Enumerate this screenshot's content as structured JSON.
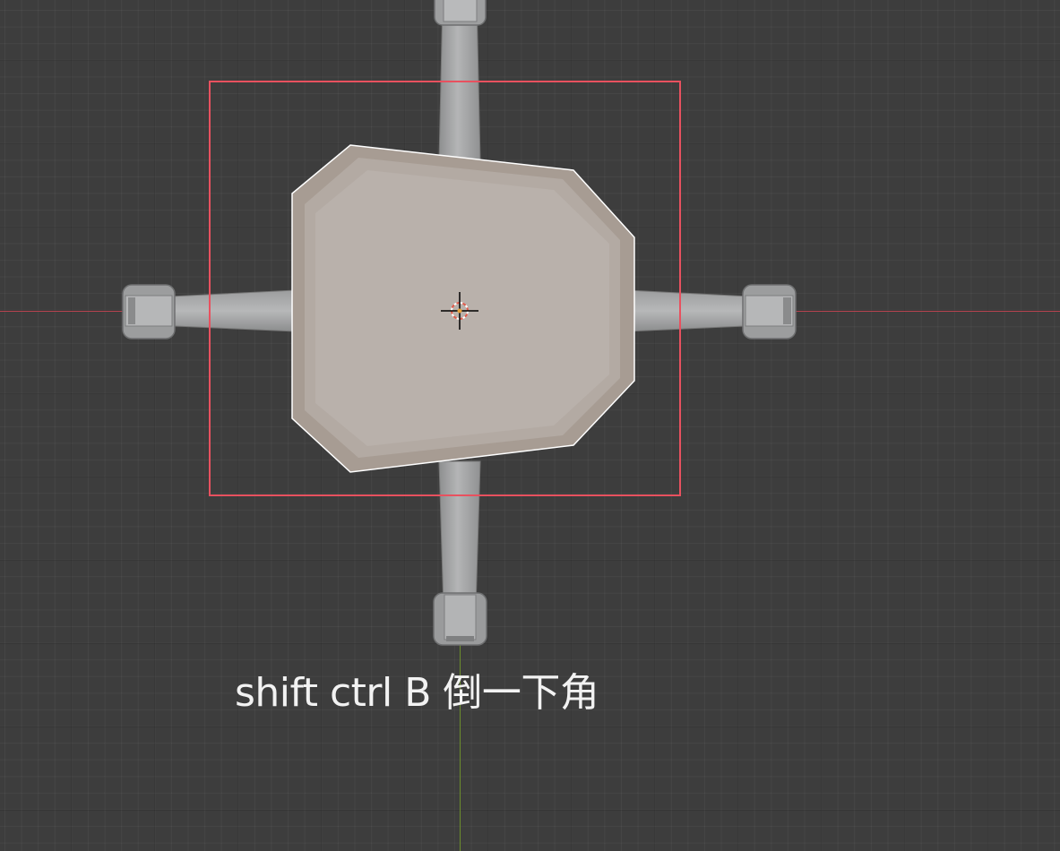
{
  "viewport": {
    "background_color": "#3d3d3d",
    "x_axis_color": "#b8434f",
    "y_axis_color": "#6c8e2c"
  },
  "selection_box": {
    "color": "#e8515f"
  },
  "seat": {
    "color": "#b8b0aa",
    "bevel_color": "#a79c93",
    "outline_color": "#ffffff"
  },
  "caption": {
    "text": "shift ctrl B  倒一下角"
  }
}
